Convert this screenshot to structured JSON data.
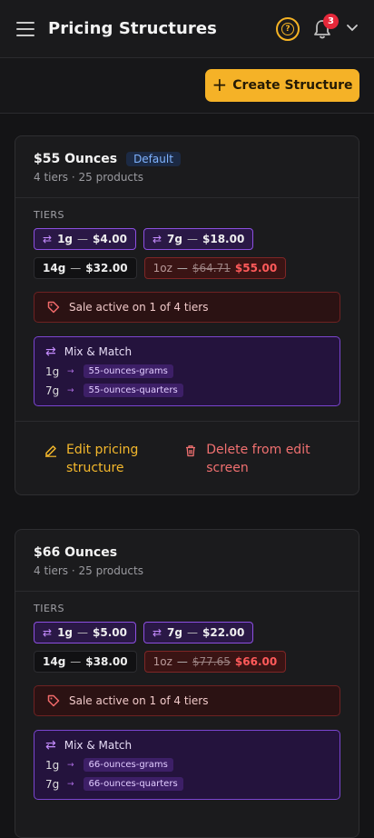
{
  "header": {
    "title": "Pricing Structures",
    "notification_count": "3",
    "help_icon": "?"
  },
  "actions": {
    "create_label": "Create Structure",
    "create_icon": "+"
  },
  "cards": [
    {
      "name": "$55 Ounces",
      "badge": "Default",
      "subtitle": "4 tiers · 25 products",
      "tiers_label": "TIERS",
      "tiers": [
        {
          "weight": "1g",
          "price": "$4.00",
          "mix": true
        },
        {
          "weight": "7g",
          "price": "$18.00",
          "mix": true
        },
        {
          "weight": "14g",
          "price": "$32.00"
        },
        {
          "weight": "1oz",
          "old_price": "$64.71",
          "price": "$55.00",
          "sale": true
        }
      ],
      "sale_text": "Sale active on 1 of 4 tiers",
      "mix_title": "Mix & Match",
      "mix_rows": [
        {
          "weight": "1g",
          "arrow": "→",
          "group": "55-ounces-grams"
        },
        {
          "weight": "7g",
          "arrow": "→",
          "group": "55-ounces-quarters"
        }
      ],
      "edit_label": "Edit pricing structure",
      "delete_label": "Delete from edit screen"
    },
    {
      "name": "$66 Ounces",
      "subtitle": "4 tiers · 25 products",
      "tiers_label": "TIERS",
      "tiers": [
        {
          "weight": "1g",
          "price": "$5.00",
          "mix": true
        },
        {
          "weight": "7g",
          "price": "$22.00",
          "mix": true
        },
        {
          "weight": "14g",
          "price": "$38.00"
        },
        {
          "weight": "1oz",
          "old_price": "$77.65",
          "price": "$66.00",
          "sale": true
        }
      ],
      "sale_text": "Sale active on 1 of 4 tiers",
      "mix_title": "Mix & Match",
      "mix_rows": [
        {
          "weight": "1g",
          "arrow": "→",
          "group": "66-ounces-grams"
        },
        {
          "weight": "7g",
          "arrow": "→",
          "group": "66-ounces-quarters"
        }
      ]
    }
  ],
  "colors": {
    "accent": "#f5b227",
    "background": "#141416",
    "card": "#1b1b1d",
    "mix_border": "#8c4fe0",
    "sale_red": "#ff5a5a",
    "badge_red": "#e5283a"
  },
  "icons": [
    "menu-icon",
    "help-icon",
    "bell-icon",
    "chevron-down-icon",
    "plus-icon",
    "swap-icon",
    "tag-icon",
    "edit-icon",
    "trash-icon"
  ]
}
